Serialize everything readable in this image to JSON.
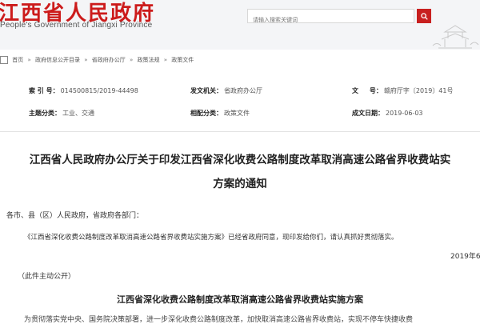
{
  "header": {
    "logo_cn": "江西省人民政府",
    "logo_en": "People's Government of Jiangxi Province",
    "search_placeholder": "请输入搜索关键词",
    "brand_color": "#cc1b1b"
  },
  "breadcrumb": {
    "items": [
      "首页",
      "政府信息公开目录",
      "省政府办公厅",
      "政策法规",
      "政策文件"
    ],
    "separator": "»"
  },
  "meta": {
    "index_label": "索 引 号：",
    "index_value": "014500815/2019-44498",
    "issuer_label": "发文机关：",
    "issuer_value": "省政府办公厅",
    "doc_no_label": "文     号：",
    "doc_no_value": "赣府厅字〔2019〕41号",
    "topic_label": "主题分类：",
    "topic_value": "工业、交通",
    "genre_label": "相配分类：",
    "genre_value": "政策文件",
    "date_label": "成文日期：",
    "date_value": "2019-06-03"
  },
  "article": {
    "title_line1": "江西省人民政府办公厅关于印发江西省深化收费公路制度改革取消高速公路省界收费站实",
    "title_line2": "方案的通知",
    "salutation": "各市、县（区）人民政府，省政府各部门：",
    "body1": "《江西省深化收费公路制度改革取消高速公路省界收费站实施方案》已经省政府同意，现印发给你们，请认真抓好贯彻落实。",
    "date_sign": "2019年6",
    "public_note": "（此件主动公开）",
    "subtitle": "江西省深化收费公路制度改革取消高速公路省界收费站实施方案",
    "body2": "为贯彻落实党中央、国务院决策部署，进一步深化收费公路制度改革，加快取消高速公路省界收费站，实现不停车快捷收费"
  }
}
